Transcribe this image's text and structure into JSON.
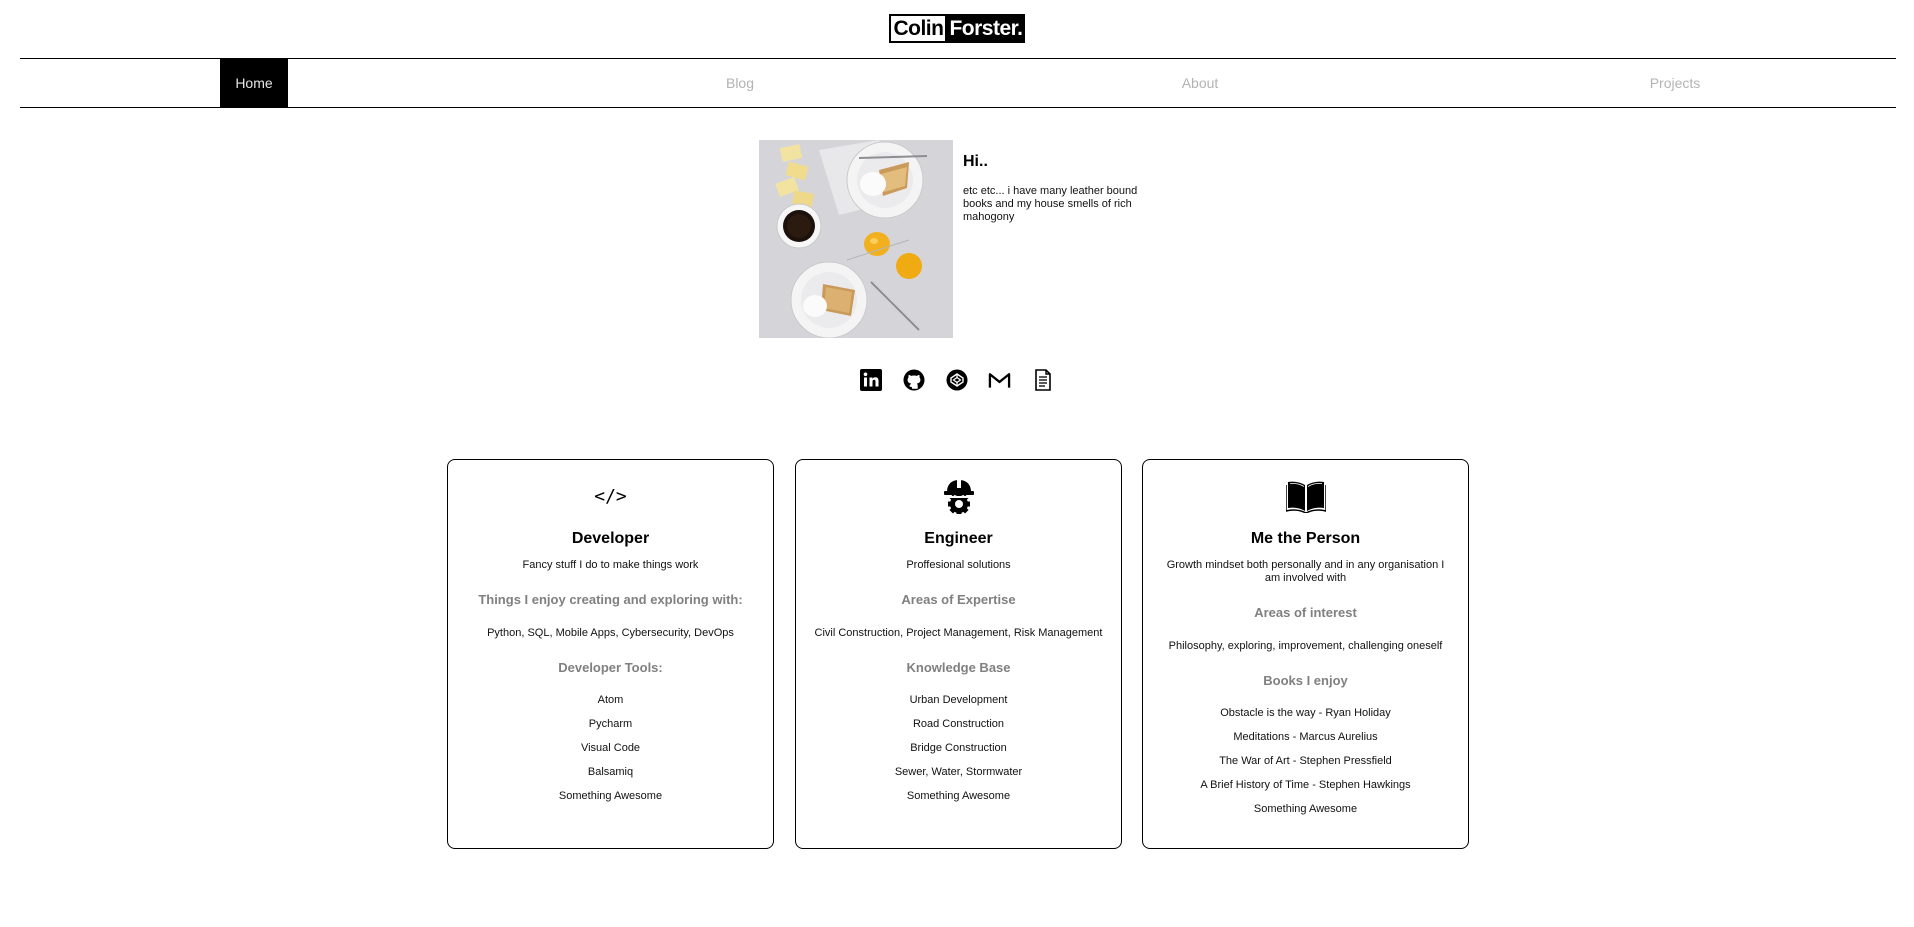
{
  "logo": {
    "first": "Colin",
    "second": "Forster."
  },
  "nav": {
    "items": [
      {
        "label": "Home",
        "active": true
      },
      {
        "label": "Blog",
        "active": false
      },
      {
        "label": "About",
        "active": false
      },
      {
        "label": "Projects",
        "active": false
      }
    ]
  },
  "intro": {
    "heading": "Hi..",
    "bio": "etc etc... i have many leather bound books and my house smells of rich mahogony"
  },
  "socials": [
    "linkedin-icon",
    "github-icon",
    "codepen-icon",
    "gmail-icon",
    "resume-icon"
  ],
  "cards": [
    {
      "icon": "code-icon",
      "icon_text": "</>",
      "title": "Developer",
      "subtitle": "Fancy stuff I do to make things work",
      "heading1": "Things I enjoy creating and exploring with:",
      "list_text": "Python, SQL, Mobile Apps, Cybersecurity, DevOps",
      "heading2": "Developer Tools:",
      "items": [
        "Atom",
        "Pycharm",
        "Visual Code",
        "Balsamiq",
        "Something Awesome"
      ]
    },
    {
      "icon": "hardhat-gear-icon",
      "title": "Engineer",
      "subtitle": "Proffesional solutions",
      "heading1": "Areas of Expertise",
      "list_text": "Civil Construction, Project Management, Risk Management",
      "heading2": "Knowledge Base",
      "items": [
        "Urban Development",
        "Road Construction",
        "Bridge Construction",
        "Sewer, Water, Stormwater",
        "Something Awesome"
      ]
    },
    {
      "icon": "open-book-icon",
      "title": "Me the Person",
      "subtitle": "Growth mindset both personally and in any organisation I am involved with",
      "heading1": "Areas of interest",
      "list_text": "Philosophy, exploring, improvement, challenging oneself",
      "heading2": "Books I enjoy",
      "items": [
        "Obstacle is the way - Ryan Holiday",
        "Meditations - Marcus Aurelius",
        "The War of Art - Stephen Pressfield",
        "A Brief History of Time - Stephen Hawkings",
        "Something Awesome"
      ]
    }
  ],
  "colors": {
    "accent": "#000000",
    "nav_inactive": "#b3b3b3",
    "section_heading": "#808080"
  }
}
